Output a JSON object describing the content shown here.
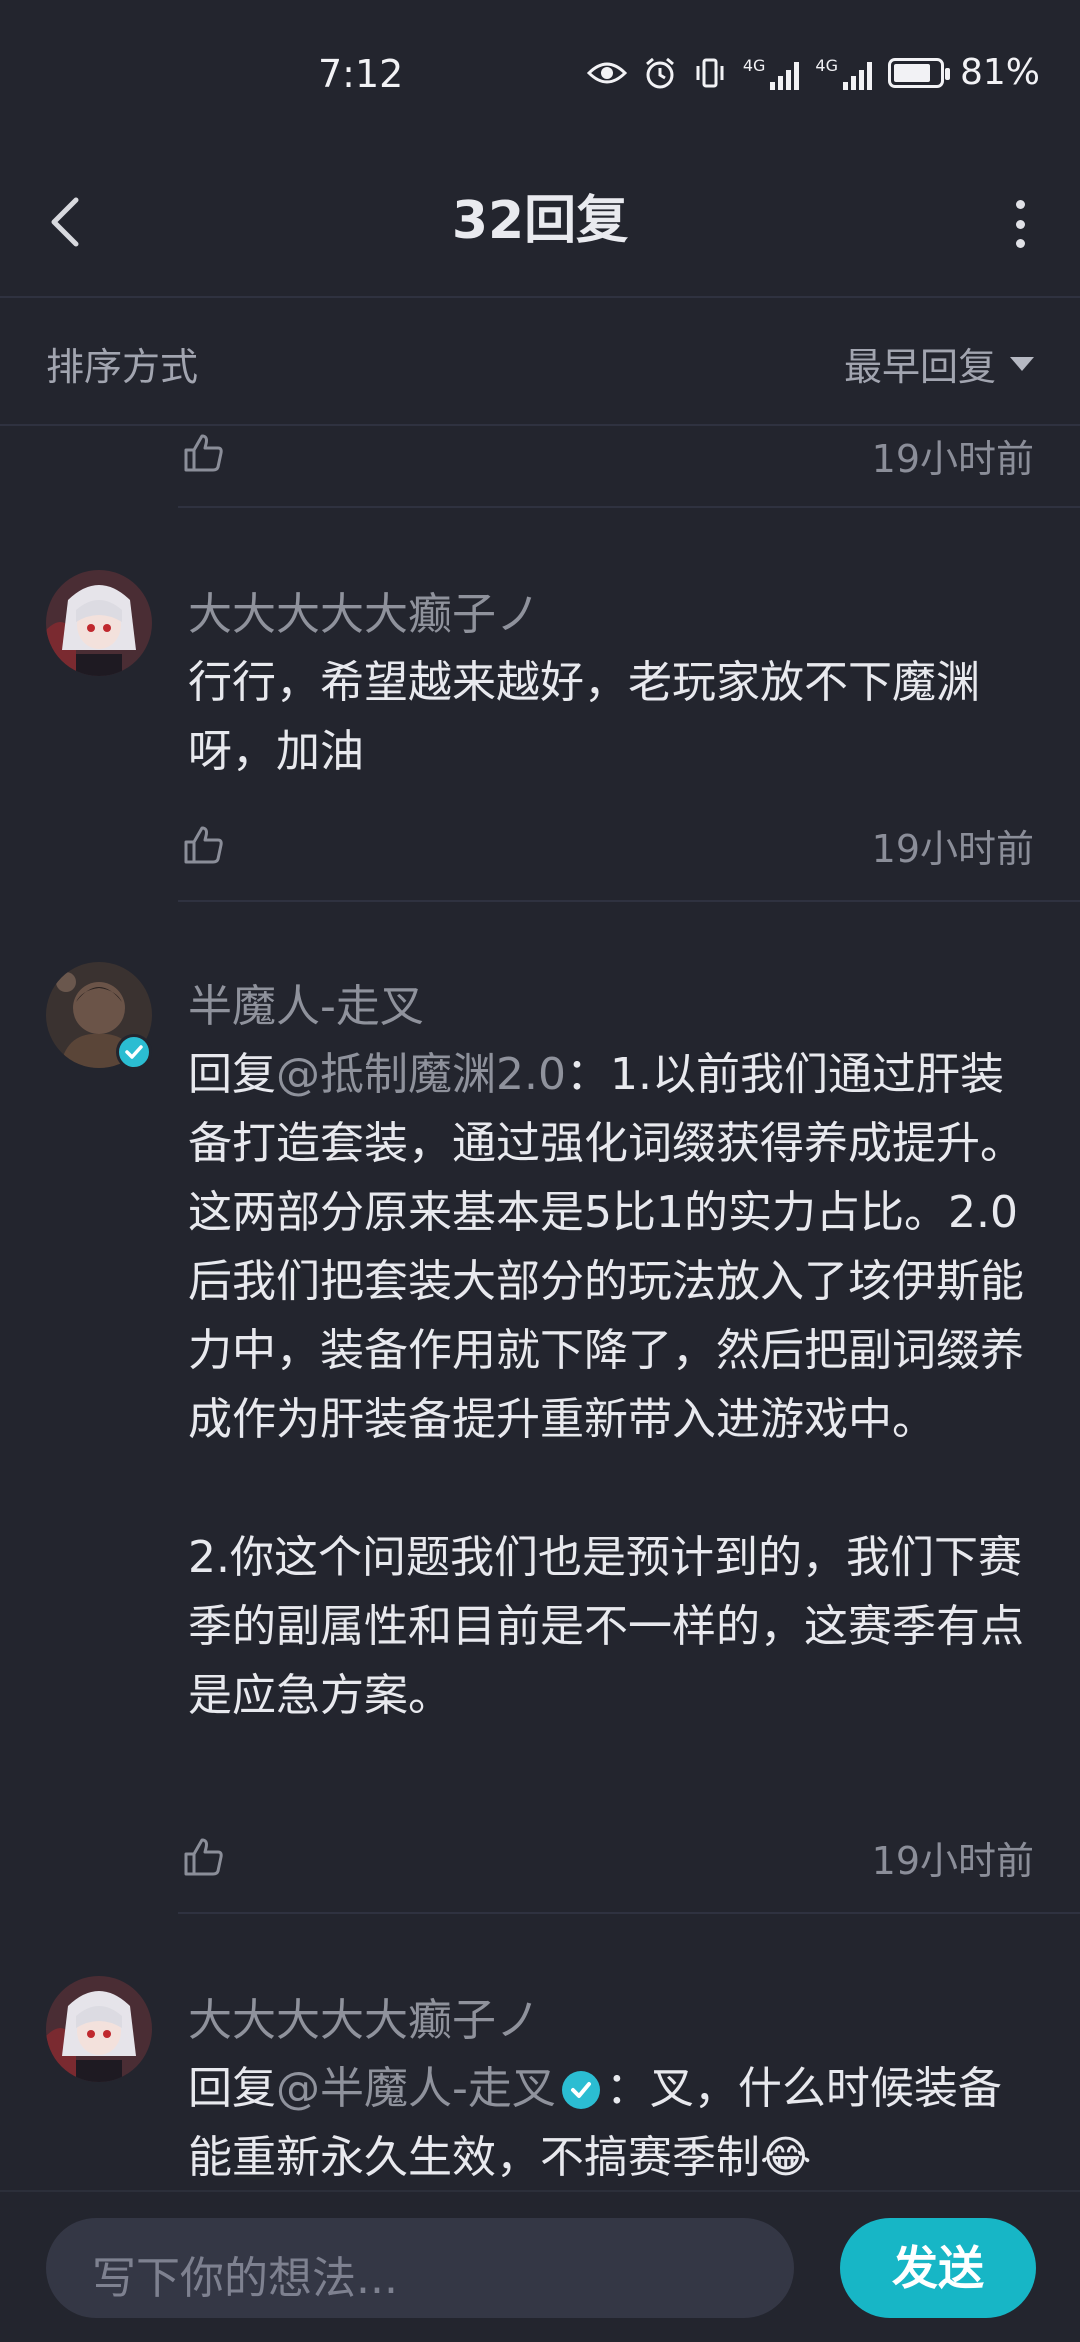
{
  "status_bar": {
    "time": "7:12",
    "net_type_1": "4G",
    "net_type_2": "4G",
    "battery_percent": "81%",
    "battery_level": 0.81
  },
  "nav": {
    "title": "32回复"
  },
  "sort": {
    "label": "排序方式",
    "selected": "最早回复"
  },
  "comments": [
    {
      "time": "19小时前"
    },
    {
      "username": "大大大大大癫子ノ",
      "text": "行行，希望越来越好，老玩家放不下魔渊呀，加油",
      "time": "19小时前"
    },
    {
      "username": "半魔人-走叉",
      "reply_prefix": "回复",
      "mention": "@抵制魔渊2.0",
      "text_p1": "：1.以前我们通过肝装备打造套装，通过强化词缀获得养成提升。这两部分原来基本是5比1的实力占比。2.0后我们把套装大部分的玩法放入了垓伊斯能力中，装备作用就下降了，然后把副词缀养成作为肝装备提升重新带入进游戏中。",
      "text_p2": "2.你这个问题我们也是预计到的，我们下赛季的副属性和目前是不一样的，这赛季有点是应急方案。",
      "time": "19小时前"
    },
    {
      "username": "大大大大大癫子ノ",
      "reply_prefix": "回复",
      "mention": "@半魔人-走叉",
      "text": "：叉，什么时候装备能重新永久生效，不搞赛季制😂"
    }
  ],
  "composer": {
    "placeholder": "写下你的想法...",
    "send_label": "发送"
  },
  "colors": {
    "background": "#23252e",
    "accent": "#17b6c6",
    "text": "#e8e9ee",
    "muted": "#8f929c"
  }
}
